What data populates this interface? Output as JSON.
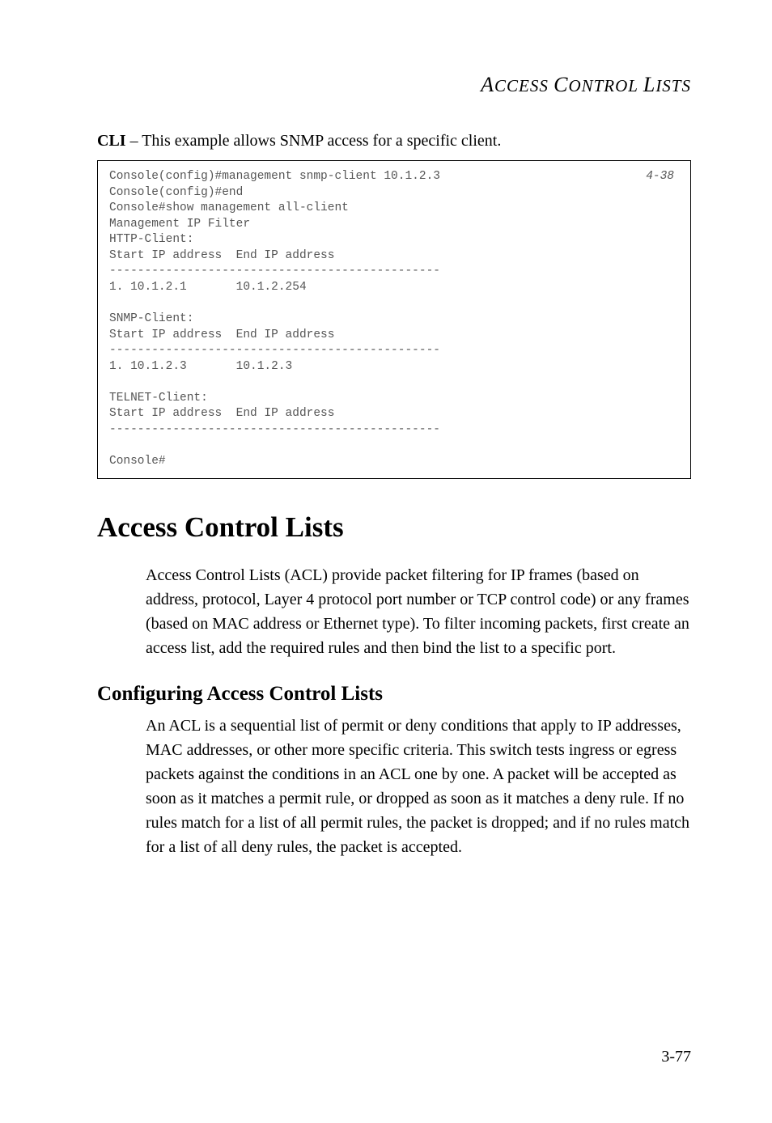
{
  "running_head": "ACCESS CONTROL LISTS",
  "intro": {
    "bold_lead": "CLI",
    "rest": " – This example allows SNMP access for a specific client."
  },
  "code": {
    "ref": "4-38",
    "text": "Console(config)#management snmp-client 10.1.2.3\nConsole(config)#end\nConsole#show management all-client\nManagement IP Filter\nHTTP-Client:\nStart IP address  End IP address\n-----------------------------------------------\n1. 10.1.2.1       10.1.2.254\n\nSNMP-Client:\nStart IP address  End IP address\n-----------------------------------------------\n1. 10.1.2.3       10.1.2.3\n\nTELNET-Client:\nStart IP address  End IP address\n-----------------------------------------------\n\nConsole#"
  },
  "section": {
    "title": "Access Control Lists",
    "paragraph": "Access Control Lists (ACL) provide packet filtering for IP frames (based on address, protocol, Layer 4 protocol port number or TCP control code) or any frames (based on MAC address or Ethernet type). To filter incoming packets, first create an access list, add the required rules and then bind the list to a specific port."
  },
  "subsection": {
    "title": "Configuring Access Control Lists",
    "paragraph": "An ACL is a sequential list of permit or deny conditions that apply to IP addresses, MAC addresses, or other more specific criteria. This switch tests ingress or egress packets against the conditions in an ACL one by one. A packet will be accepted as soon as it matches a permit rule, or dropped as soon as it matches a deny rule. If no rules match for a list of all permit rules, the packet is dropped; and if no rules match for a list of all deny rules, the packet is accepted."
  },
  "page_number": "3-77"
}
